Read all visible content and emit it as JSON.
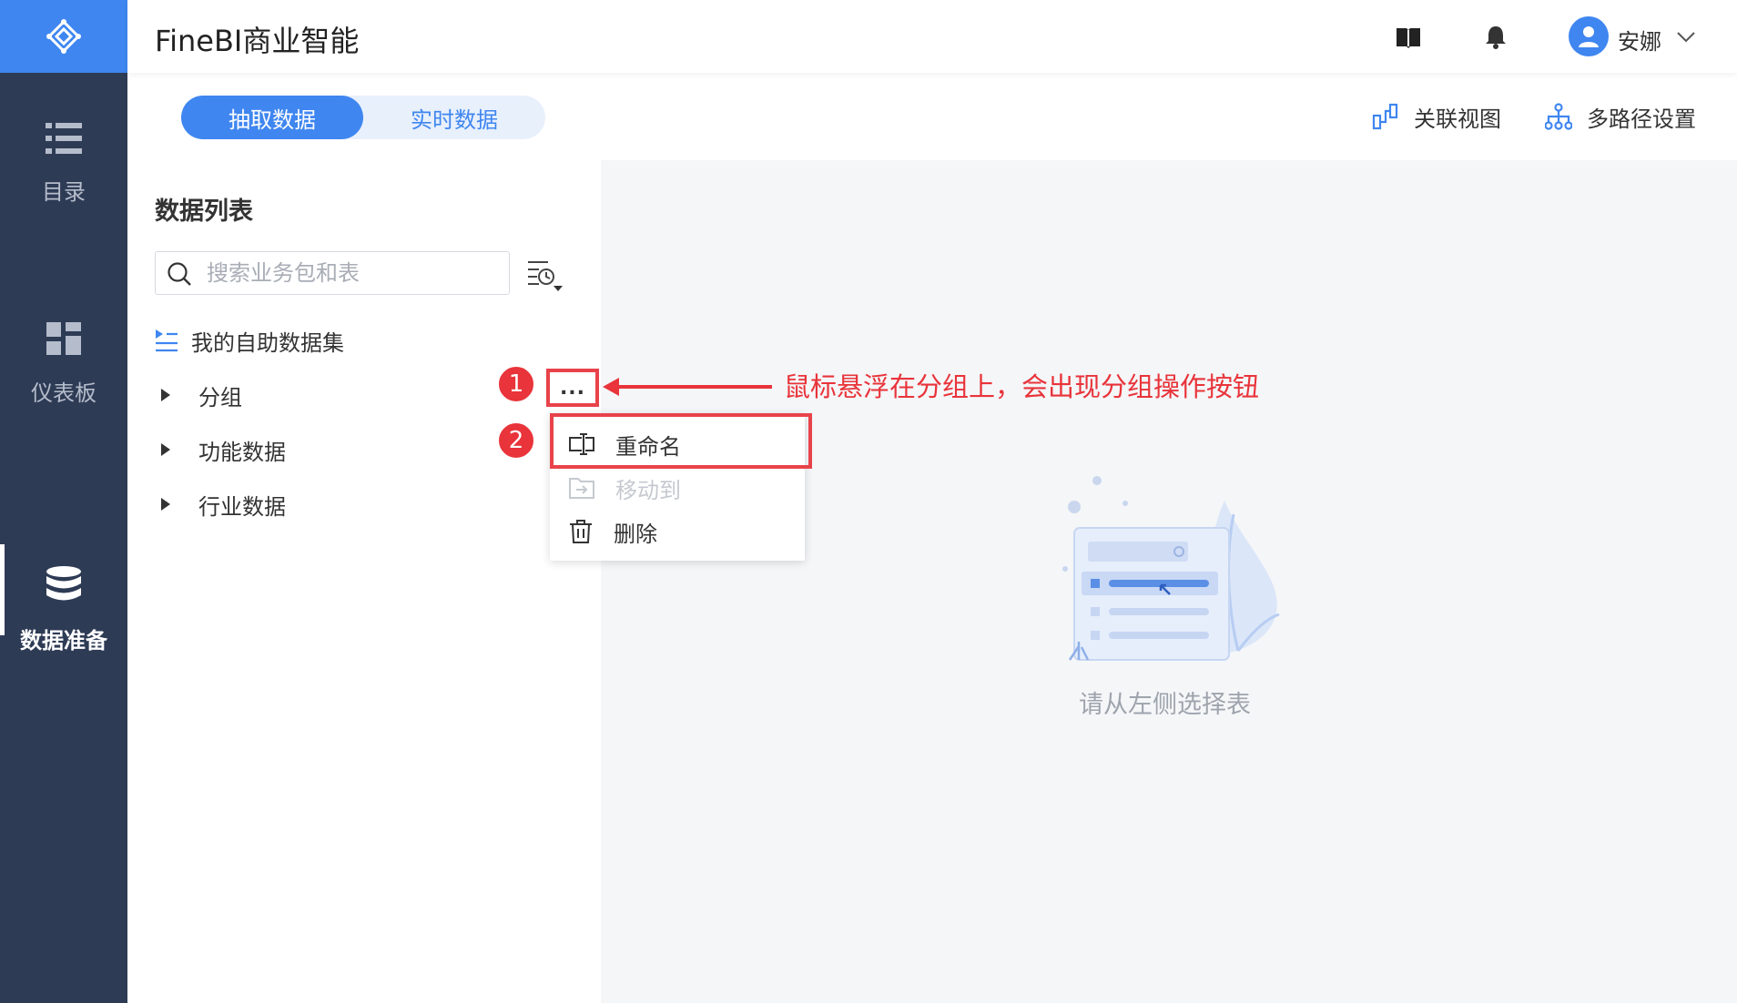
{
  "header": {
    "title": "FineBI商业智能",
    "username": "安娜"
  },
  "nav": {
    "items": [
      {
        "label": "目录",
        "icon": "list-icon"
      },
      {
        "label": "仪表板",
        "icon": "dashboard-icon"
      },
      {
        "label": "数据准备",
        "icon": "database-icon",
        "active": true
      }
    ]
  },
  "tabs": {
    "extract": "抽取数据",
    "realtime": "实时数据"
  },
  "actions": {
    "relation_view": "关联视图",
    "multipath": "多路径设置"
  },
  "panel": {
    "title": "数据列表",
    "search_placeholder": "搜索业务包和表",
    "items": [
      "我的自助数据集",
      "分组",
      "功能数据",
      "行业数据"
    ]
  },
  "menu": {
    "dots": "...",
    "rename": "重命名",
    "move_to": "移动到",
    "delete": "删除"
  },
  "empty_state": {
    "text": "请从左侧选择表"
  },
  "annotations": {
    "badge1": "1",
    "badge2": "2",
    "note": "鼠标悬浮在分组上，会出现分组操作按钮"
  },
  "colors": {
    "accent": "#3f86f0",
    "rail": "#2e3b55",
    "annotation": "#e8343a"
  }
}
